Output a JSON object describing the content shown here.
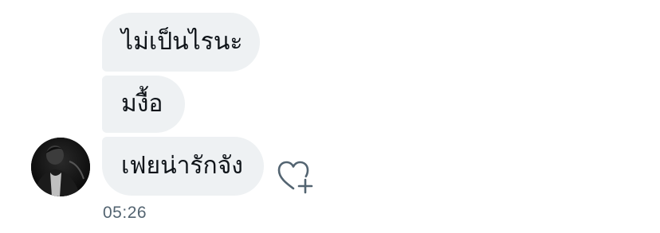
{
  "messages": [
    {
      "text": "ไม่เป็นไรนะ"
    },
    {
      "text": "มงื้อ"
    },
    {
      "text": "เฟยน่ารักจัง"
    }
  ],
  "timestamp": "05:26",
  "icons": {
    "avatar": "user-avatar-photo",
    "react": "heart-plus-icon"
  },
  "colors": {
    "bubble": "#eef1f3",
    "text": "#0f1419",
    "meta": "#536471"
  }
}
